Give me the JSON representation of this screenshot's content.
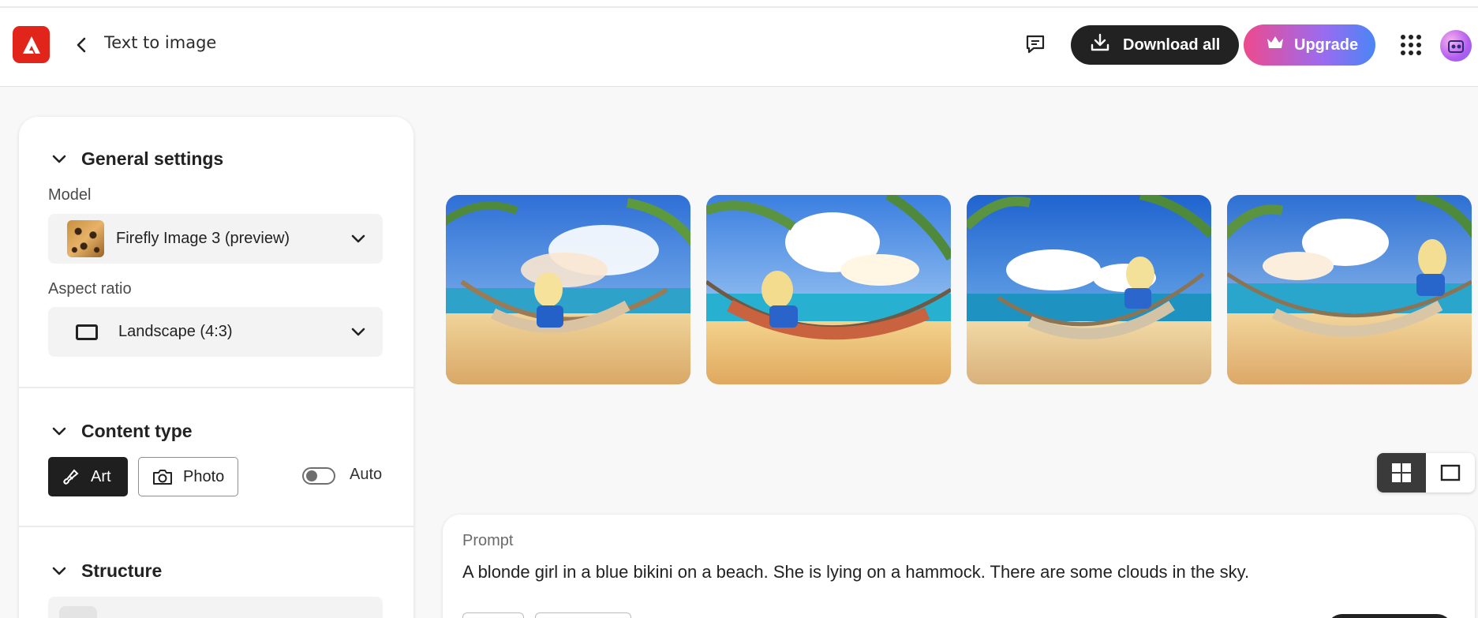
{
  "header": {
    "title": "Text to image",
    "download_label": "Download all",
    "upgrade_label": "Upgrade"
  },
  "panel": {
    "general": {
      "title": "General settings",
      "model_label": "Model",
      "model_value": "Firefly Image 3 (preview)",
      "aspect_label": "Aspect ratio",
      "aspect_value": "Landscape (4:3)"
    },
    "content_type": {
      "title": "Content type",
      "art_label": "Art",
      "photo_label": "Photo",
      "auto_label": "Auto",
      "selected": "Art",
      "auto_enabled": false
    },
    "structure": {
      "title": "Structure"
    }
  },
  "gallery": {
    "images": [
      {
        "icon": "generated-image"
      },
      {
        "icon": "generated-image"
      },
      {
        "icon": "generated-image"
      },
      {
        "icon": "generated-image"
      }
    ],
    "view_mode": "grid"
  },
  "prompt": {
    "label": "Prompt",
    "text": "A blonde girl in a blue bikini on a beach. She is lying on a hammock. There are some clouds in the sky."
  },
  "colors": {
    "brand": "#e1251b",
    "dark_button": "#222222",
    "upgrade_gradient_start": "#ed4a8d",
    "upgrade_gradient_end": "#4a86f5"
  }
}
